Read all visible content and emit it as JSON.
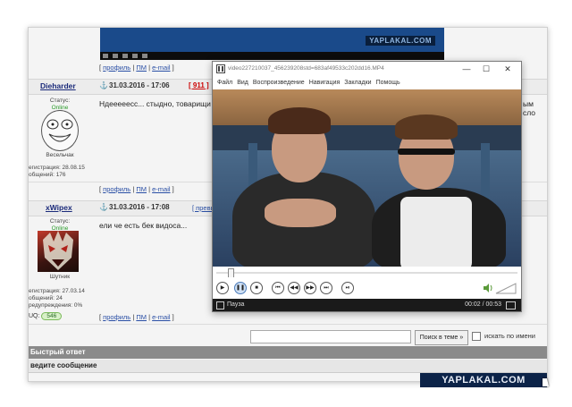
{
  "forum": {
    "top_logo": "YAPLAKAL.COM",
    "post_links_1": {
      "open": "[ ",
      "profile": "профиль",
      "sep1": " | ",
      "pm": "ПМ",
      "sep2": " | ",
      "email": "e-mail",
      "close": " ]"
    },
    "post1": {
      "nick": "Dieharder",
      "date": "31.03.2016 - 17:06",
      "number": "911",
      "status_label": "Статус:",
      "status_value": "Online",
      "rank": "Весельчак",
      "registered": "егистрация: 28.08.15",
      "messages": "общений: 176",
      "message": "Ндееееесс... стыдно, товарищи",
      "message_tail": "ым сло"
    },
    "post_links_2": {
      "open": "[ ",
      "profile": "профиль",
      "sep1": " | ",
      "pm": "ПМ",
      "sep2": " | ",
      "email": "e-mail",
      "close": " ]"
    },
    "post2": {
      "nick": "xWipex",
      "date": "31.03.2016 - 17:08",
      "preview_link": "[ превь",
      "status_label": "Статус:",
      "status_value": "Online",
      "rank": "Шутник",
      "registered": "егистрация: 27.03.14",
      "messages": "общений: 24",
      "warnings": "редупреждения: 0%",
      "message": "ели че есть бек видоса...",
      "uq_label": "UQ:",
      "uq_value": "546"
    },
    "post_links_3": {
      "open": "[ ",
      "profile": "профиль",
      "sep1": " | ",
      "pm": "ПМ",
      "sep2": " | ",
      "email": "e-mail",
      "close": " ]"
    },
    "search_button": "Поиск в теме »",
    "search_names_label": "искать по имени",
    "quick_reply": "Быстрый ответ",
    "enter_message": "ведите сообщение",
    "bottom_logo": "YAPLAKAL.COM"
  },
  "player": {
    "title": "video227210037_456239208std=683af49533c202dd16.MP4",
    "menu": [
      "Файл",
      "Вид",
      "Воспроизведение",
      "Навигация",
      "Закладки",
      "Помощь"
    ],
    "window_buttons": {
      "minimize": "—",
      "maximize": "☐",
      "close": "✕"
    },
    "controls": {
      "play": "▶",
      "pause": "❚❚",
      "stop": "■",
      "prev": "⏮",
      "rewind": "◀◀",
      "forward": "▶▶",
      "next": "⏭",
      "frame": "⏯"
    },
    "status": "Пауза",
    "time": "00:02 / 00:53",
    "progress": 0.04
  }
}
